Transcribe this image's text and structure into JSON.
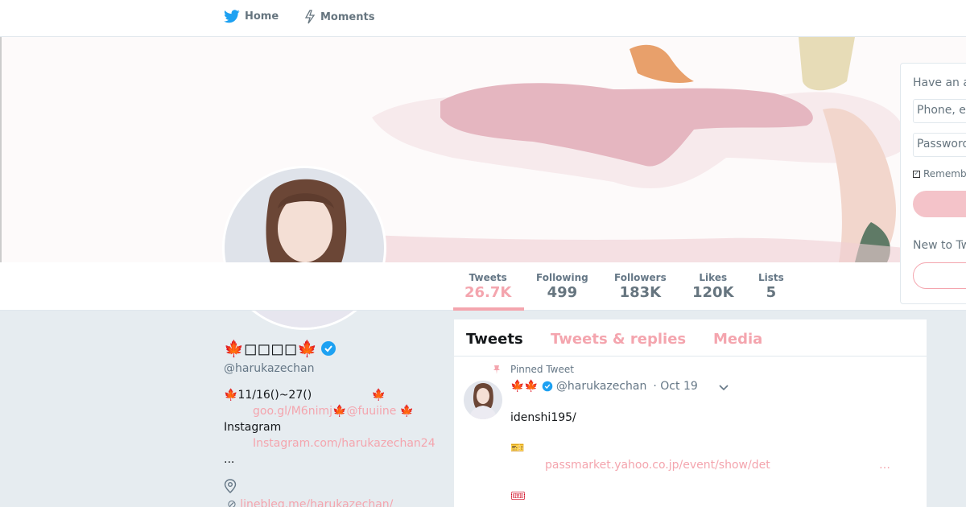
{
  "nav": {
    "home_label": "Home",
    "moments_label": "Moments"
  },
  "colors": {
    "accent": "#f4a5ae",
    "verified": "#1da1f2",
    "nav_icon": "#1da1f2"
  },
  "profile": {
    "name": "🍁◻◻◻◻🍁",
    "handle": "@harukazechan",
    "bio": {
      "line1": "🍁11/16()~27()",
      "line1_tail": "🍁",
      "line2_link1": "goo.gl/M6nimj",
      "line2_sep": "🍁",
      "line2_link2": "@fuuiine",
      "line2_tail": "🍁",
      "line3": "Instagram",
      "line4_link": "Instagram.com/harukazechan24",
      "line5": "..."
    },
    "website": "linebleg.me/harukazechan/"
  },
  "stats": [
    {
      "label": "Tweets",
      "value": "26.7K"
    },
    {
      "label": "Following",
      "value": "499"
    },
    {
      "label": "Followers",
      "value": "183K"
    },
    {
      "label": "Likes",
      "value": "120K"
    },
    {
      "label": "Lists",
      "value": "5"
    }
  ],
  "login": {
    "have_account": "Have an a",
    "phone_placeholder": "Phone, e",
    "password_placeholder": "Password",
    "remember": "Rememb",
    "new_to": "New to Tw"
  },
  "timeline": {
    "tabs": [
      "Tweets",
      "Tweets & replies",
      "Media"
    ],
    "pinned_label": "Pinned Tweet",
    "tweet": {
      "name": "🍁🍁",
      "handle": "@harukazechan",
      "date": "· Oct 19",
      "text": "idenshi195/",
      "ticket_icon": "🎫",
      "link": "passmarket.yahoo.co.jp/event/show/det",
      "more": "…",
      "ticket2_icon": "🎟"
    }
  }
}
